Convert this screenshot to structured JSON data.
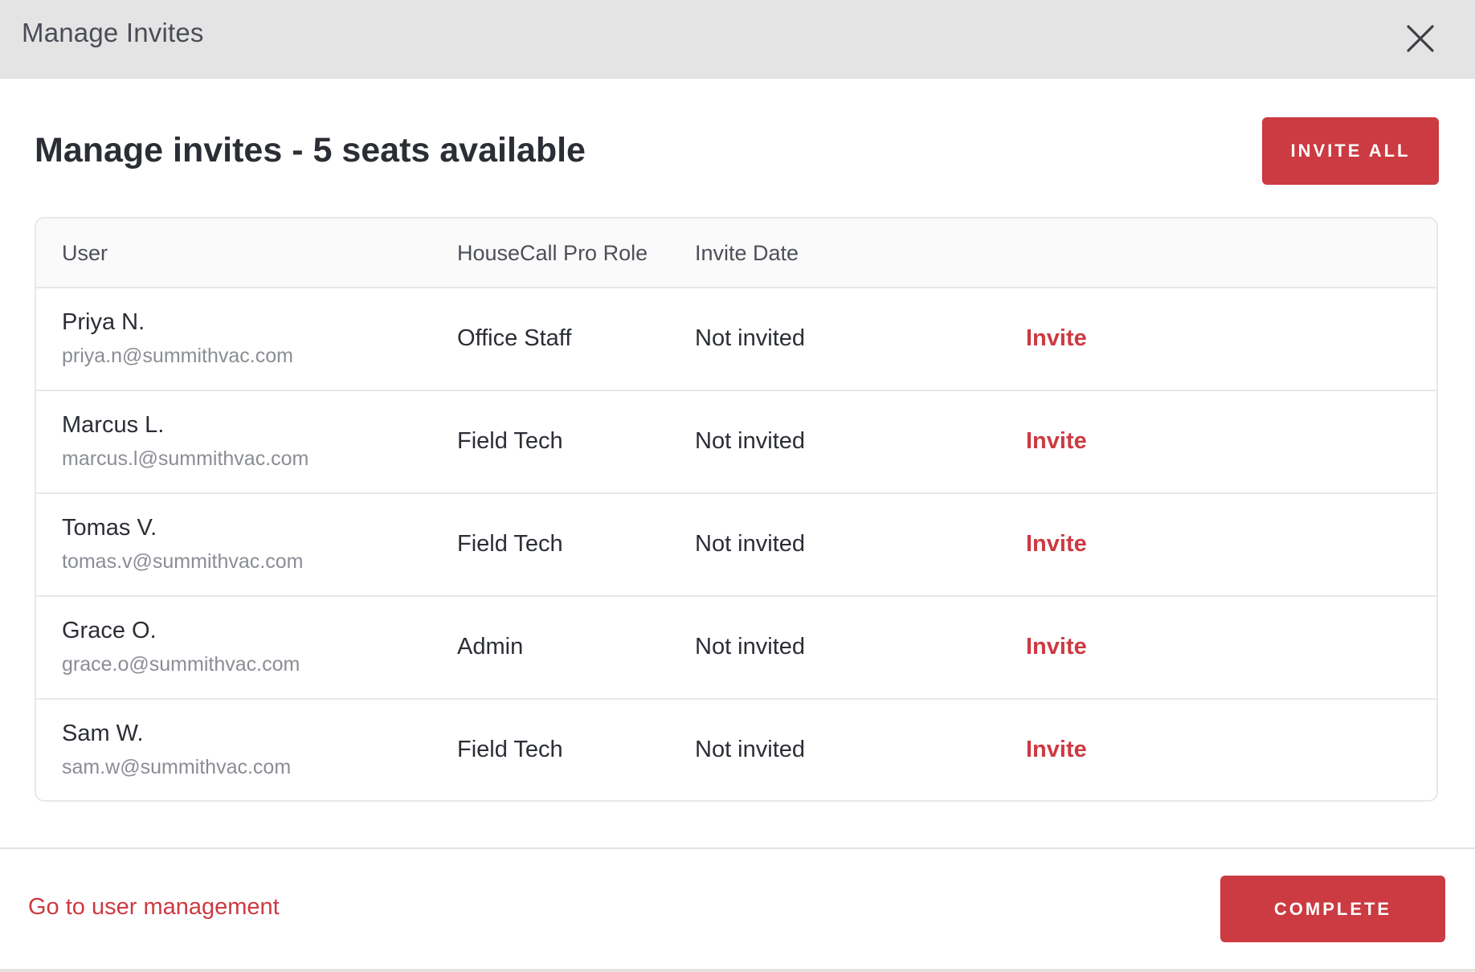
{
  "header": {
    "title": "Manage Invites",
    "close_icon": "close-icon"
  },
  "main": {
    "title": "Manage invites - 5 seats available",
    "invite_all_label": "INVITE ALL"
  },
  "table": {
    "columns": {
      "user": "User",
      "role": "HouseCall Pro Role",
      "date": "Invite Date"
    },
    "rows": [
      {
        "name": "Priya N.",
        "email": "priya.n@summithvac.com",
        "role": "Office Staff",
        "date": "Not invited",
        "action": "Invite"
      },
      {
        "name": "Marcus L.",
        "email": "marcus.l@summithvac.com",
        "role": "Field Tech",
        "date": "Not invited",
        "action": "Invite"
      },
      {
        "name": "Tomas V.",
        "email": "tomas.v@summithvac.com",
        "role": "Field Tech",
        "date": "Not invited",
        "action": "Invite"
      },
      {
        "name": "Grace O.",
        "email": "grace.o@summithvac.com",
        "role": "Admin",
        "date": "Not invited",
        "action": "Invite"
      },
      {
        "name": "Sam W.",
        "email": "sam.w@summithvac.com",
        "role": "Field Tech",
        "date": "Not invited",
        "action": "Invite"
      }
    ]
  },
  "footer": {
    "link_label": "Go to user management",
    "complete_label": "COMPLETE"
  },
  "colors": {
    "accent": "#cc3a42",
    "header_bg": "#e4e4e4",
    "text": "#2b2e35",
    "muted": "#8a8d94"
  }
}
